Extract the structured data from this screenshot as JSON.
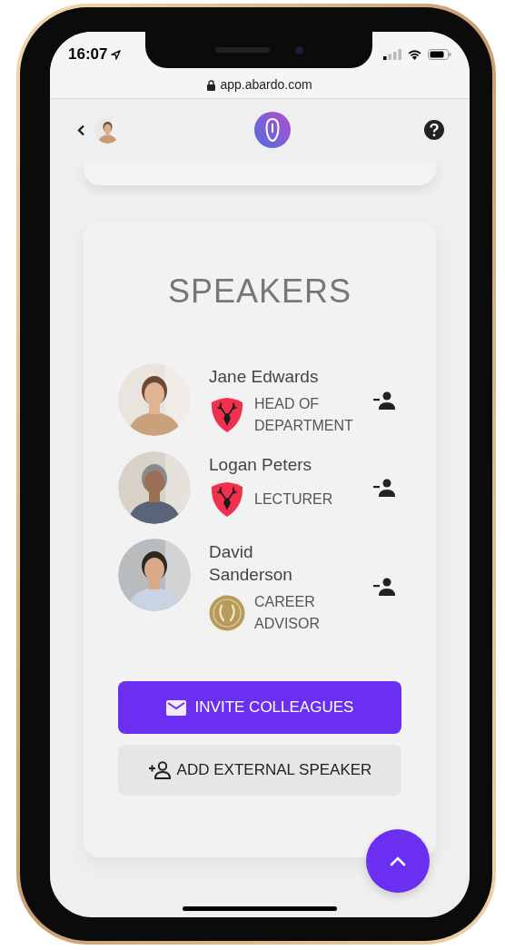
{
  "status_bar": {
    "time": "16:07"
  },
  "browser": {
    "url": "app.abardo.com"
  },
  "section": {
    "title": "SPEAKERS"
  },
  "speakers": [
    {
      "name": "Jane Edwards",
      "role": "HEAD OF DEPARTMENT",
      "badge": {
        "kind": "shield"
      }
    },
    {
      "name": "Logan Peters",
      "role": "LECTURER",
      "badge": {
        "kind": "shield"
      }
    },
    {
      "name": "David Sanderson",
      "role": "CAREER ADVISOR",
      "badge": {
        "kind": "seal"
      }
    }
  ],
  "buttons": [
    {
      "kind": "primary",
      "label": "INVITE COLLEAGUES"
    },
    {
      "kind": "secondary",
      "label": "ADD EXTERNAL SPEAKER"
    }
  ]
}
